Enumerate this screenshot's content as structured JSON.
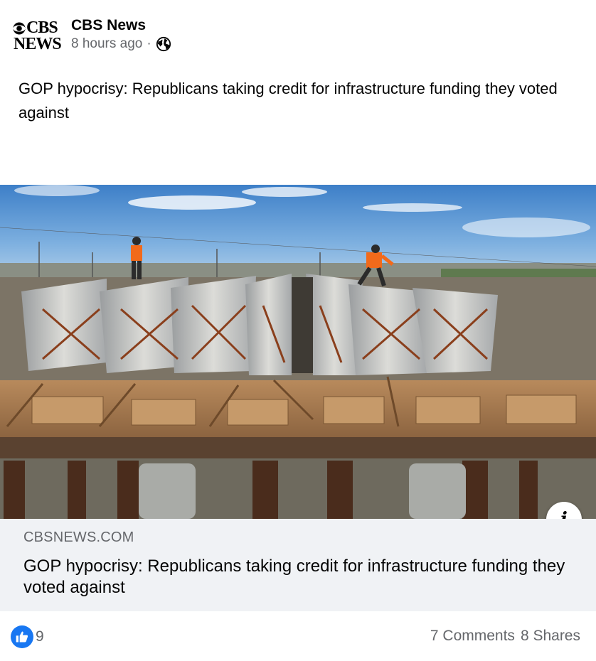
{
  "header": {
    "logo_line1": "CBS",
    "logo_line2": "NEWS",
    "page_name": "CBS News",
    "timestamp": "8 hours ago",
    "separator": "·",
    "privacy_icon": "globe-icon"
  },
  "post": {
    "text": "GOP hypocrisy: Republicans taking credit for infrastructure funding they voted against"
  },
  "link": {
    "image_alt": "Construction workers on bridge girders under a blue sky",
    "info_icon": "info-icon",
    "info_label": "i",
    "domain": "CBSNEWS.COM",
    "title": "GOP hypocrisy: Republicans taking credit for infrastructure funding they voted against"
  },
  "footer": {
    "reaction_icon": "like-icon",
    "reaction_count": "9",
    "comments": "7 Comments",
    "shares": "8 Shares"
  },
  "colors": {
    "secondary_text": "#65676b",
    "like_blue": "#1877f2",
    "link_footer_bg": "#f0f2f5"
  }
}
